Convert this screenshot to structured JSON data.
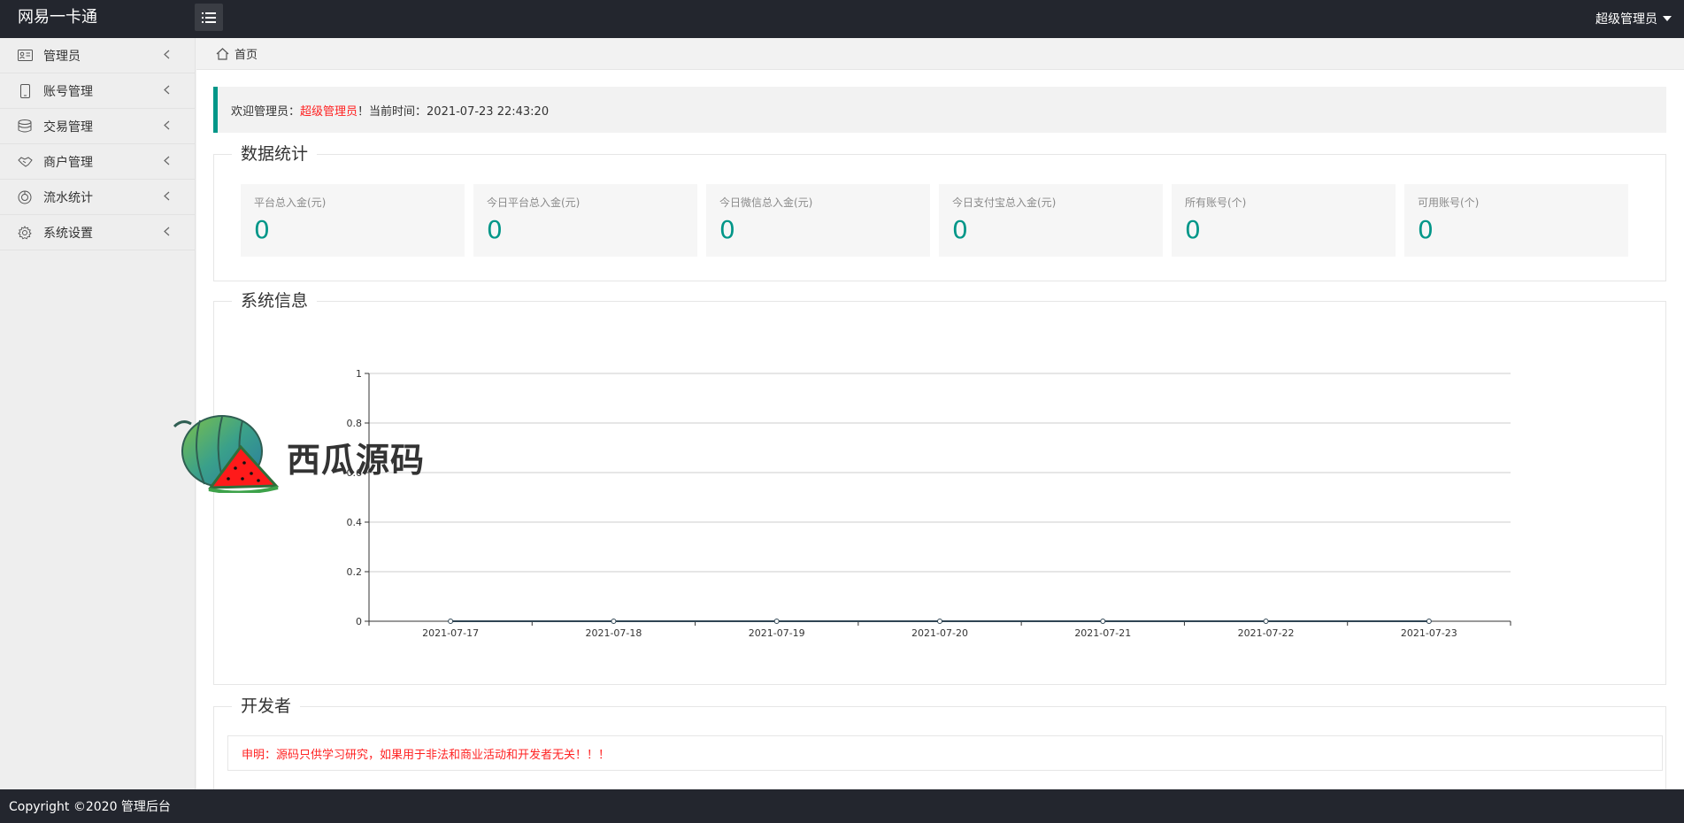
{
  "topbar": {
    "brand": "网易一卡通",
    "menu_toggle_icon": "hamburger-icon",
    "user_name": "超级管理员"
  },
  "sidebar": {
    "items": [
      {
        "label": "管理员",
        "icon": "id-card-icon"
      },
      {
        "label": "账号管理",
        "icon": "mobile-icon"
      },
      {
        "label": "交易管理",
        "icon": "database-icon"
      },
      {
        "label": "商户管理",
        "icon": "handshake-icon"
      },
      {
        "label": "流水统计",
        "icon": "chart-ring-icon"
      },
      {
        "label": "系统设置",
        "icon": "gear-icon"
      }
    ]
  },
  "breadcrumb": {
    "home": "首页"
  },
  "welcome": {
    "prefix": "欢迎管理员：",
    "admin_name": "超级管理员",
    "suffix": "！当前时间：2021-07-23 22:43:20"
  },
  "stats": {
    "legend": "数据统计",
    "cards": [
      {
        "title": "平台总入金(元)",
        "value": "0"
      },
      {
        "title": "今日平台总入金(元)",
        "value": "0"
      },
      {
        "title": "今日微信总入金(元)",
        "value": "0"
      },
      {
        "title": "今日支付宝总入金(元)",
        "value": "0"
      },
      {
        "title": "所有账号(个)",
        "value": "0"
      },
      {
        "title": "可用账号(个)",
        "value": "0"
      }
    ]
  },
  "system": {
    "legend": "系统信息"
  },
  "chart_data": {
    "type": "line",
    "categories": [
      "2021-07-17",
      "2021-07-18",
      "2021-07-19",
      "2021-07-20",
      "2021-07-21",
      "2021-07-22",
      "2021-07-23"
    ],
    "series": [
      {
        "values": [
          0,
          0,
          0,
          0,
          0,
          0,
          0
        ]
      }
    ],
    "ylim": [
      0,
      1
    ],
    "yticks": [
      "0",
      "0.2",
      "0.4",
      "0.6",
      "0.8",
      "1"
    ],
    "grid": true
  },
  "developer": {
    "legend": "开发者",
    "notice": "申明：源码只供学习研究，如果用于非法和商业活动和开发者无关！！！"
  },
  "watermark": {
    "text": "西瓜源码"
  },
  "footer": {
    "copyright": "Copyright ©2020 管理后台"
  },
  "colors": {
    "accent": "#009688",
    "danger": "#ff2222",
    "topbar": "#23262e"
  }
}
